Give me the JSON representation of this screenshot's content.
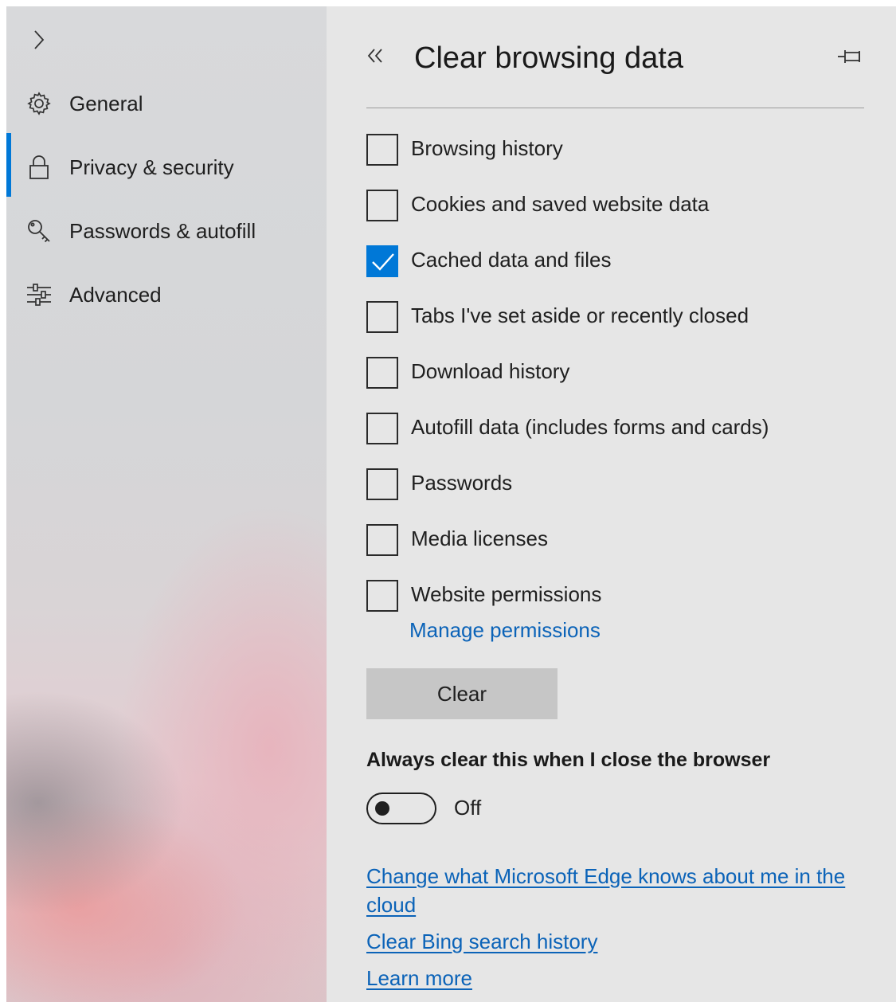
{
  "sidebar": {
    "expand_icon": "chevron-right-icon",
    "items": [
      {
        "label": "General",
        "icon": "gear-icon",
        "active": false
      },
      {
        "label": "Privacy & security",
        "icon": "lock-icon",
        "active": true
      },
      {
        "label": "Passwords & autofill",
        "icon": "key-icon",
        "active": false
      },
      {
        "label": "Advanced",
        "icon": "sliders-icon",
        "active": false
      }
    ]
  },
  "panel": {
    "back_icon": "double-chevron-left-icon",
    "title": "Clear browsing data",
    "pin_icon": "pin-icon",
    "options": [
      {
        "label": "Browsing history",
        "checked": false
      },
      {
        "label": "Cookies and saved website data",
        "checked": false
      },
      {
        "label": "Cached data and files",
        "checked": true
      },
      {
        "label": "Tabs I've set aside or recently closed",
        "checked": false
      },
      {
        "label": "Download history",
        "checked": false
      },
      {
        "label": "Autofill data (includes forms and cards)",
        "checked": false
      },
      {
        "label": "Passwords",
        "checked": false
      },
      {
        "label": "Media licenses",
        "checked": false
      },
      {
        "label": "Website permissions",
        "checked": false
      }
    ],
    "manage_permissions_link": "Manage permissions",
    "clear_button": "Clear",
    "always_clear": {
      "heading": "Always clear this when I close the browser",
      "state": "Off",
      "on": false
    },
    "links": [
      "Change what Microsoft Edge knows about me in the cloud",
      "Clear Bing search history",
      "Learn more"
    ]
  },
  "colors": {
    "accent": "#0078d7",
    "link": "#0b63b8",
    "panel_bg": "#e6e6e6",
    "clear_button_bg": "#c6c6c6"
  }
}
